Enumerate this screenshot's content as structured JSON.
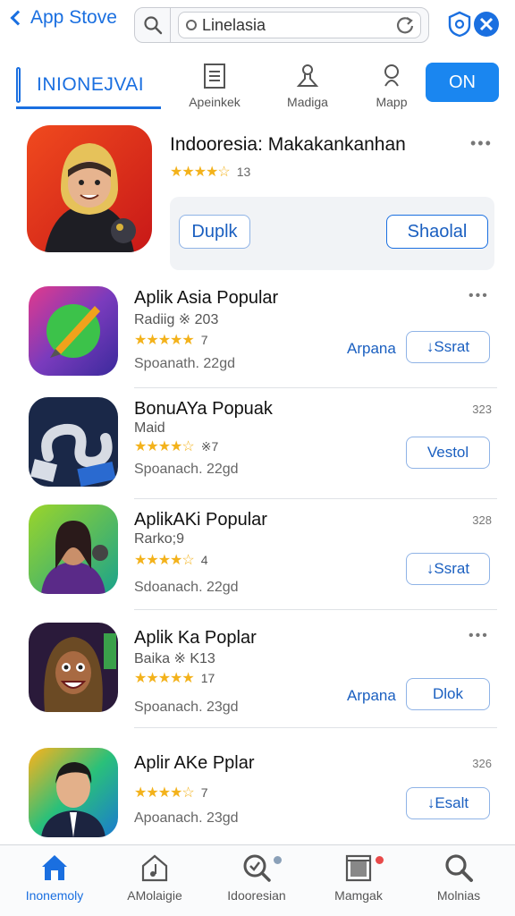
{
  "header": {
    "back_label": "App Stove",
    "search_value": "Linelasia"
  },
  "segments": {
    "active_label": "INIONEJVAI",
    "items": [
      {
        "label": "Apeinkek",
        "icon": "document-icon"
      },
      {
        "label": "Madiga",
        "icon": "flask-icon"
      },
      {
        "label": "Mapp",
        "icon": "map-pin-icon"
      }
    ],
    "on_button": "ON"
  },
  "featured": {
    "title": "Indooresia: Makakankanhan",
    "stars": "★★★★☆",
    "rating_count": "13",
    "btn_left": "Duplk",
    "btn_right": "Shaolal"
  },
  "apps": [
    {
      "title": "Aplik Asia Popular",
      "subtitle": "Radiig ※ 203",
      "stars": "★★★★★",
      "rating": "7",
      "meta": "Spoanath. 22gd",
      "count": "",
      "link": "Arpana",
      "button": "↓Ssrat"
    },
    {
      "title": "BonuAYa Popuak",
      "subtitle": "Maid",
      "stars": "★★★★☆",
      "rating": "※7",
      "meta": "Spoanach. 22gd",
      "count": "323",
      "link": "",
      "button": "Vestol"
    },
    {
      "title": "AplikAKi Popular",
      "subtitle": "Rarko;9",
      "stars": "★★★★☆",
      "rating": "4",
      "meta": "Sdoanach. 22gd",
      "count": "328",
      "link": "",
      "button": "↓Ssrat"
    },
    {
      "title": "Aplik Ka Poplar",
      "subtitle": "Baika ※ K13",
      "stars": "★★★★★",
      "rating": "17",
      "meta": "Spoanach. 23gd",
      "count": "",
      "link": "Arpana",
      "button": "Dlok"
    },
    {
      "title": "Aplir AKe Pplar",
      "subtitle": "",
      "stars": "★★★★☆",
      "rating": "7",
      "meta": "Apoanach. 23gd",
      "count": "326",
      "link": "",
      "button": "↓Esalt"
    }
  ],
  "tabbar": [
    {
      "label": "Inonemoly",
      "icon": "home-icon"
    },
    {
      "label": "AMolaigie",
      "icon": "music-house-icon"
    },
    {
      "label": "Idooresian",
      "icon": "search-badge-icon"
    },
    {
      "label": "Mamgak",
      "icon": "archive-icon"
    },
    {
      "label": "Molnias",
      "icon": "search-icon"
    }
  ],
  "colors": {
    "accent": "#1a6fe0",
    "on_button": "#1a86f0",
    "star": "#f3b21b"
  }
}
